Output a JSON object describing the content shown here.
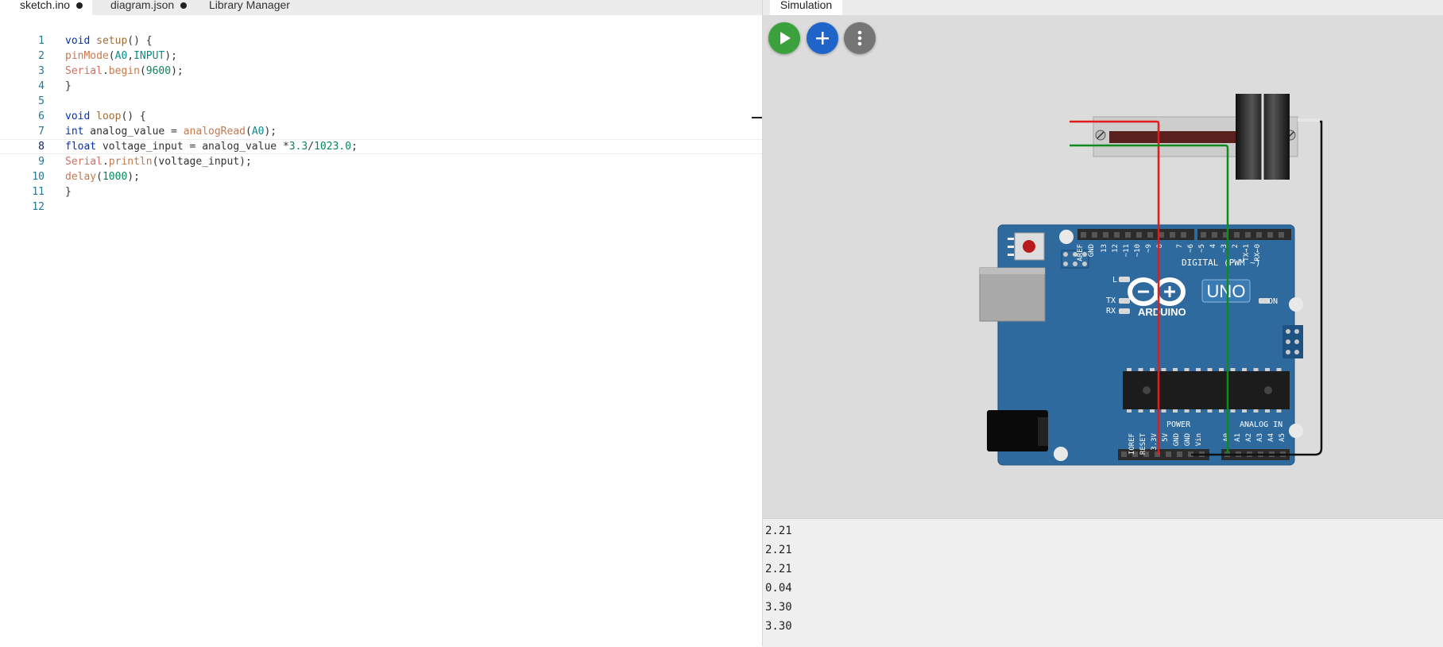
{
  "editor": {
    "tabs": [
      {
        "label": "sketch.ino",
        "modified": true,
        "active": true
      },
      {
        "label": "diagram.json",
        "modified": true,
        "active": false
      },
      {
        "label": "Library Manager",
        "modified": false,
        "active": false
      }
    ],
    "active_line": 8,
    "code_lines": [
      {
        "n": "1",
        "tokens": [
          [
            "kw",
            "void"
          ],
          [
            "pu",
            " "
          ],
          [
            "fn2",
            "setup"
          ],
          [
            "pu",
            "() {"
          ]
        ]
      },
      {
        "n": "2",
        "tokens": [
          [
            "fn",
            "pinMode"
          ],
          [
            "pu",
            "("
          ],
          [
            "cn",
            "A0"
          ],
          [
            "pu",
            ","
          ],
          [
            "cn",
            "INPUT"
          ],
          [
            "pu",
            ");"
          ]
        ]
      },
      {
        "n": "3",
        "tokens": [
          [
            "sr",
            "Serial"
          ],
          [
            "pu",
            "."
          ],
          [
            "fn",
            "begin"
          ],
          [
            "pu",
            "("
          ],
          [
            "nm",
            "9600"
          ],
          [
            "pu",
            ");"
          ]
        ]
      },
      {
        "n": "4",
        "tokens": [
          [
            "pu",
            "}"
          ]
        ]
      },
      {
        "n": "5",
        "tokens": []
      },
      {
        "n": "6",
        "tokens": [
          [
            "kw",
            "void"
          ],
          [
            "pu",
            " "
          ],
          [
            "fn2",
            "loop"
          ],
          [
            "pu",
            "() {"
          ]
        ]
      },
      {
        "n": "7",
        "tokens": [
          [
            "kw",
            "int"
          ],
          [
            "pu",
            " analog_value = "
          ],
          [
            "fn",
            "analogRead"
          ],
          [
            "pu",
            "("
          ],
          [
            "cn",
            "A0"
          ],
          [
            "pu",
            ");"
          ]
        ]
      },
      {
        "n": "8",
        "tokens": [
          [
            "kw",
            "float"
          ],
          [
            "pu",
            " voltage_input = analog_value *"
          ],
          [
            "nm",
            "3.3"
          ],
          [
            "pu",
            "/"
          ],
          [
            "nm",
            "1023.0"
          ],
          [
            "pu",
            ";"
          ]
        ]
      },
      {
        "n": "9",
        "tokens": [
          [
            "sr",
            "Serial"
          ],
          [
            "pu",
            "."
          ],
          [
            "fn",
            "println"
          ],
          [
            "pu",
            "(voltage_input);"
          ]
        ]
      },
      {
        "n": "10",
        "tokens": [
          [
            "fn",
            "delay"
          ],
          [
            "pu",
            "("
          ],
          [
            "nm",
            "1000"
          ],
          [
            "pu",
            ");"
          ]
        ]
      },
      {
        "n": "11",
        "tokens": [
          [
            "pu",
            "}"
          ]
        ]
      },
      {
        "n": "12",
        "tokens": []
      }
    ]
  },
  "simulation": {
    "tab_label": "Simulation",
    "buttons": {
      "play_icon": "play-icon",
      "add_icon": "plus-icon",
      "more_icon": "more-vertical-icon"
    },
    "board": {
      "brand": "ARDUINO",
      "model": "UNO",
      "on_label": "ON",
      "tx_label": "TX",
      "rx_label": "RX",
      "l_label": "L",
      "digital_label": "DIGITAL (PWM ~)",
      "power_label": "POWER",
      "analog_label": "ANALOG IN",
      "digital_pins": [
        "AREF",
        "GND",
        "13",
        "12",
        "~11",
        "~10",
        "~9",
        "8",
        "7",
        "~6",
        "~5",
        "4",
        "~3",
        "2",
        "TX→1",
        "RX←0"
      ],
      "power_pins": [
        "IOREF",
        "RESET",
        "3.3V",
        "5V",
        "GND",
        "GND",
        "Vin"
      ],
      "analog_pins": [
        "A0",
        "A1",
        "A2",
        "A3",
        "A4",
        "A5"
      ]
    },
    "serial_output": [
      "2.21",
      "2.21",
      "2.21",
      "0.04",
      "3.30",
      "3.30"
    ],
    "colors": {
      "play": "#3aa13d",
      "add": "#1f65c9",
      "more": "#757575",
      "board": "#2e6a9e",
      "wire_vcc": "#e21b1b",
      "wire_signal": "#0e8a1f",
      "wire_gnd": "#111111"
    }
  }
}
